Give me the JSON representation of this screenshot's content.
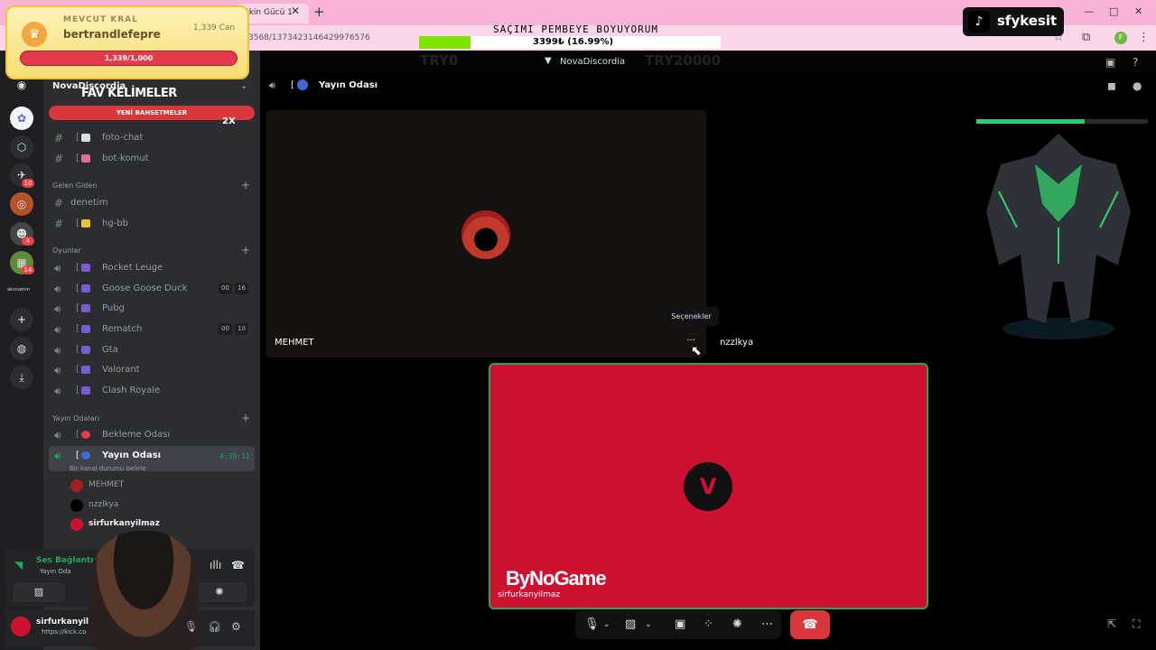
{
  "browser": {
    "tab_title": "ğkin Gücü 1",
    "url": "3568/1373423146429976576",
    "window_controls": [
      "—",
      "□",
      "✕"
    ]
  },
  "discord": {
    "title": "NovaDiscordia",
    "server_name": "NovaDiscordia",
    "stage_title": "Yayın Odası"
  },
  "overlay": {
    "goal_title": "SAÇIMI PEMBEYE BOYUYORUM",
    "goal_value": "3399₺ (16.99%)",
    "goal_fraction": 0.1699,
    "try_left": "TRY0",
    "try_right": "TRY20000",
    "king_label": "MEVCUT KRAL",
    "king_name": "bertrandlefepre",
    "king_can": "1,339 Can",
    "king_progress": "1,339/1,000",
    "fav_words": "FAV KELİMELER",
    "mention_bar": "YENİ BAHSETMELER",
    "multiplier": "2X",
    "tiktok_name": "sfykesit",
    "sponsor": "ByNoGame"
  },
  "rail": {
    "badges": [
      "10",
      "4",
      "14"
    ],
    "label_small": "akıcısenin"
  },
  "channels": {
    "text": [
      {
        "name": "foto-chat"
      },
      {
        "name": "bot-komut"
      }
    ],
    "cat_gelen": "Gelen Giden",
    "gelen": [
      {
        "name": "denetim"
      },
      {
        "name": "hg-bb"
      }
    ],
    "cat_oyunlar": "Oyunlar",
    "oyunlar": [
      {
        "name": "Rocket Leuge"
      },
      {
        "name": "Goose Goose Duck",
        "c1": "00",
        "c2": "16"
      },
      {
        "name": "Pubg"
      },
      {
        "name": "Rematch",
        "c1": "00",
        "c2": "10"
      },
      {
        "name": "Gta"
      },
      {
        "name": "Valorant"
      },
      {
        "name": "Clash Royale"
      }
    ],
    "cat_yayin": "Yayın Odaları",
    "yayin": [
      {
        "name": "Bekleme Odası"
      },
      {
        "name": "Yayın Odası",
        "status": "Bir kanal durumu belirle",
        "timer": "4:39:11"
      }
    ],
    "members": [
      "MEHMET",
      "nzzlkya",
      "sirfurkanyilmaz"
    ]
  },
  "voice_panel": {
    "title": "Ses Bağlantısı",
    "sub": "Yayın Oda",
    "username": "sirfurkanyilmaz",
    "user_status": "https://kick.co"
  },
  "stage": {
    "tiles": [
      {
        "name": "MEHMET"
      },
      {
        "name": "nzzlkya"
      },
      {
        "name": "sirfurkanyilmaz"
      }
    ],
    "tooltip": "Seçenekler",
    "more": "···",
    "boss_health": 0.63
  },
  "colors": {
    "accent_green": "#23a55a",
    "hangup_red": "#da373c",
    "tile_red": "#cf1131",
    "tab_pink": "#f6b3d6"
  },
  "icons": {
    "speaker": "speaker-icon",
    "hash": "hash-icon",
    "mic": "microphone-icon",
    "camera": "camera-off-icon",
    "screen": "screen-share-icon",
    "activities": "activities-icon",
    "soundboard": "soundboard-icon",
    "more": "more-icon",
    "hangup": "hangup-icon"
  }
}
